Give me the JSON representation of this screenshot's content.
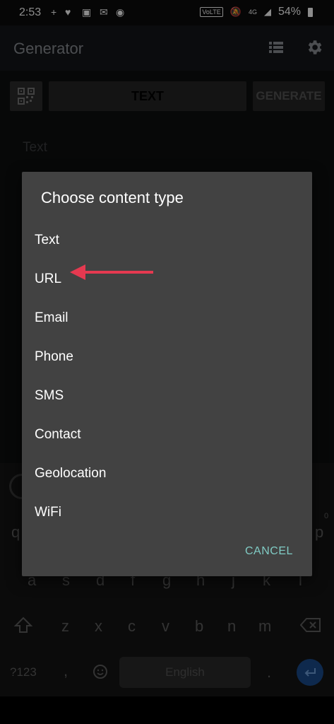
{
  "status_bar": {
    "time": "2:53",
    "network": "VoLTE",
    "signal": "4G",
    "battery": "54%"
  },
  "app_bar": {
    "title": "Generator"
  },
  "toolbar": {
    "type_label": "TEXT",
    "generate_label": "GENERATE"
  },
  "content": {
    "field_label": "Text"
  },
  "dialog": {
    "title": "Choose content type",
    "options": [
      "Text",
      "URL",
      "Email",
      "Phone",
      "SMS",
      "Contact",
      "Geolocation",
      "WiFi"
    ],
    "cancel_label": "CANCEL"
  },
  "keyboard": {
    "row2": [
      "a",
      "s",
      "d",
      "f",
      "g",
      "h",
      "j",
      "k",
      "l"
    ],
    "row3": [
      "z",
      "x",
      "c",
      "v",
      "b",
      "n",
      "m"
    ],
    "symbols_label": "?123",
    "comma": ",",
    "period": ".",
    "space_label": "English",
    "row1_partial": [
      "q",
      "p"
    ],
    "hint_zero": "0"
  },
  "colors": {
    "accent": "#80cbc4",
    "dialog_bg": "#424242",
    "arrow": "#e53950",
    "enter_key": "#1a4c8c"
  }
}
